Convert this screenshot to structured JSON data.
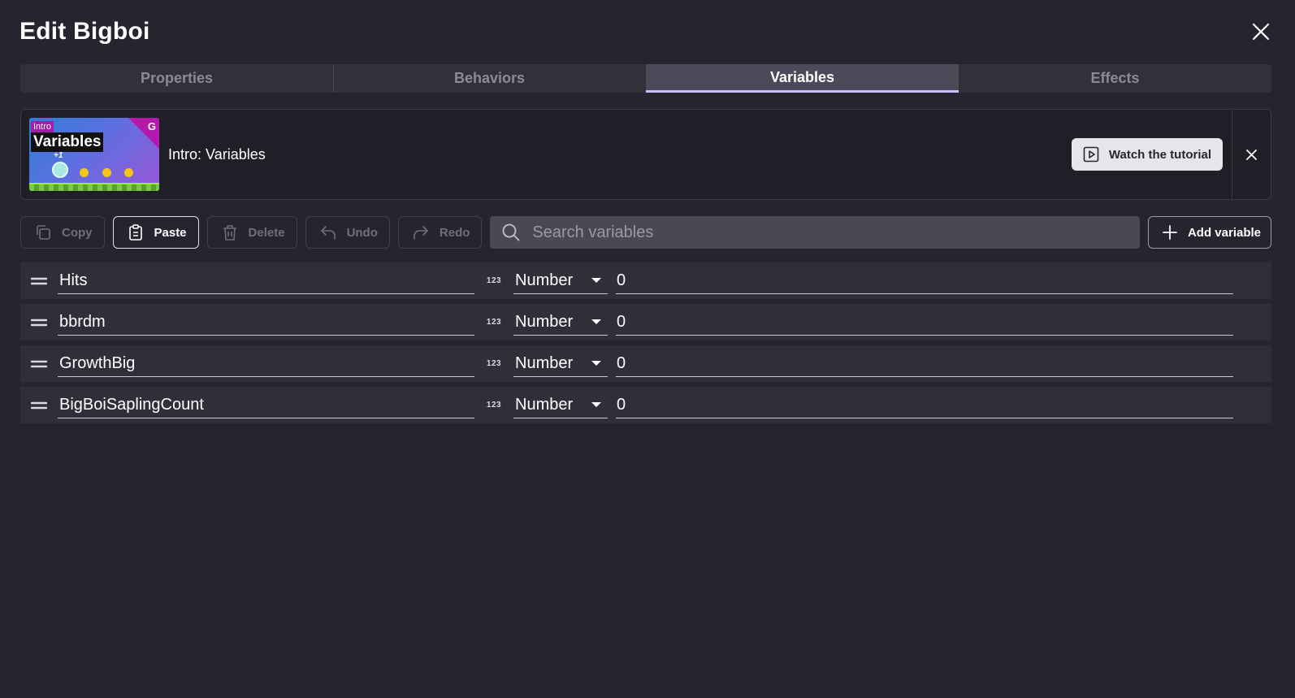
{
  "dialog": {
    "title": "Edit Bigboi"
  },
  "tabs": [
    {
      "label": "Properties",
      "active": false
    },
    {
      "label": "Behaviors",
      "active": false
    },
    {
      "label": "Variables",
      "active": true
    },
    {
      "label": "Effects",
      "active": false
    }
  ],
  "tutorial": {
    "thumbnail_tag": "Intro",
    "thumbnail_title": "Variables",
    "thumbnail_plus": "+1",
    "thumbnail_logo": "G",
    "label": "Intro: Variables",
    "watch_label": "Watch the tutorial"
  },
  "toolbar": {
    "copy_label": "Copy",
    "paste_label": "Paste",
    "delete_label": "Delete",
    "undo_label": "Undo",
    "redo_label": "Redo",
    "search_placeholder": "Search variables",
    "add_label": "Add variable"
  },
  "variables": [
    {
      "name": "Hits",
      "type_icon": "123",
      "type": "Number",
      "value": "0"
    },
    {
      "name": "bbrdm",
      "type_icon": "123",
      "type": "Number",
      "value": "0"
    },
    {
      "name": "GrowthBig",
      "type_icon": "123",
      "type": "Number",
      "value": "0"
    },
    {
      "name": "BigBoiSaplingCount",
      "type_icon": "123",
      "type": "Number",
      "value": "0"
    }
  ],
  "colors": {
    "background": "#25252f",
    "tab_active_underline": "#c7c2ff",
    "search_bg": "#494955"
  }
}
